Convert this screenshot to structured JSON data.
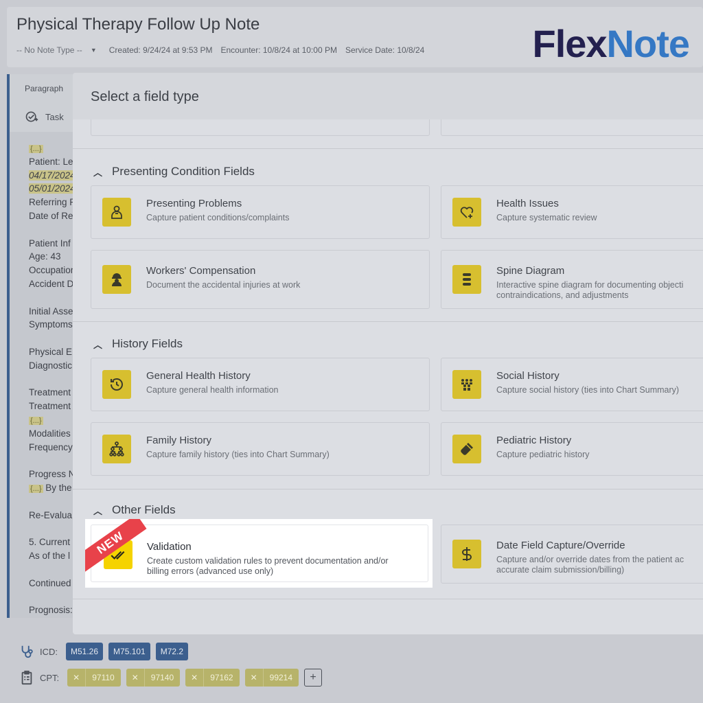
{
  "header": {
    "title": "Physical Therapy Follow Up Note",
    "note_type": "-- No Note Type --",
    "created": "Created: 9/24/24 at 9:53 PM",
    "encounter": "Encounter: 10/8/24 at 10:00 PM",
    "service_date": "Service Date: 10/8/24",
    "logo_part1": "Flex",
    "logo_part2": "Note"
  },
  "editor": {
    "toolbar_paragraph": "Paragraph",
    "toolbar_task": "Task",
    "lines": [
      "{...}",
      "Patient: Le",
      "04/17/2024",
      "05/01/2024",
      "Referring P",
      "Date of Re",
      "Patient Inf",
      "Age: 43",
      "Occupation",
      "Accident D",
      "Initial Asse",
      "Symptoms",
      "Physical E",
      "Diagnostic",
      "Treatment",
      "Treatment",
      "{...}",
      "Modalities",
      "Frequency",
      "Progress N",
      "By the",
      "Re-Evalua",
      "5. Current",
      "As of the l",
      "Continued",
      "Prognosis:"
    ]
  },
  "modal": {
    "title": "Select a field type",
    "sections": [
      {
        "title": "Presenting Condition Fields",
        "cards": [
          {
            "title": "Presenting Problems",
            "desc": "Capture patient conditions/complaints",
            "icon": "patient-icon"
          },
          {
            "title": "Health Issues",
            "desc": "Capture systematic review",
            "icon": "heart-plus-icon"
          },
          {
            "title": "Workers' Compensation",
            "desc": "Document the accidental injuries at work",
            "icon": "worker-icon"
          },
          {
            "title": "Spine Diagram",
            "desc": "Interactive spine diagram for documenting objecti",
            "desc2": "contraindications, and adjustments",
            "icon": "spine-icon"
          }
        ]
      },
      {
        "title": "History Fields",
        "cards": [
          {
            "title": "General Health History",
            "desc": "Capture general health information",
            "icon": "history-icon"
          },
          {
            "title": "Social History",
            "desc": "Capture social history (ties into Chart Summary)",
            "icon": "people-icon"
          },
          {
            "title": "Family History",
            "desc": "Capture family history (ties into Chart Summary)",
            "icon": "family-tree-icon"
          },
          {
            "title": "Pediatric History",
            "desc": "Capture pediatric history",
            "icon": "bottle-icon"
          }
        ]
      },
      {
        "title": "Other Fields",
        "cards": [
          {
            "title": "Validation",
            "desc": "Create custom validation rules to prevent documentation and/or",
            "desc2": "billing errors (advanced use only)",
            "icon": "double-check-icon",
            "badge": "NEW"
          },
          {
            "title": "Date Field Capture/Override",
            "desc": "Capture and/or override dates from the patient ac",
            "desc2": "accurate claim submission/billing)",
            "icon": "dollar-icon"
          }
        ]
      }
    ]
  },
  "codes": {
    "icd_label": "ICD:",
    "icd": [
      "M51.26",
      "M75.101",
      "M72.2"
    ],
    "cpt_label": "CPT:",
    "cpt": [
      "97110",
      "97140",
      "97162",
      "99214"
    ],
    "remove_glyph": "✕",
    "add_glyph": "+"
  },
  "colors": {
    "accent_yellow": "#f5d300",
    "navy": "#3c5f8e",
    "new_badge": "#e8424a"
  }
}
